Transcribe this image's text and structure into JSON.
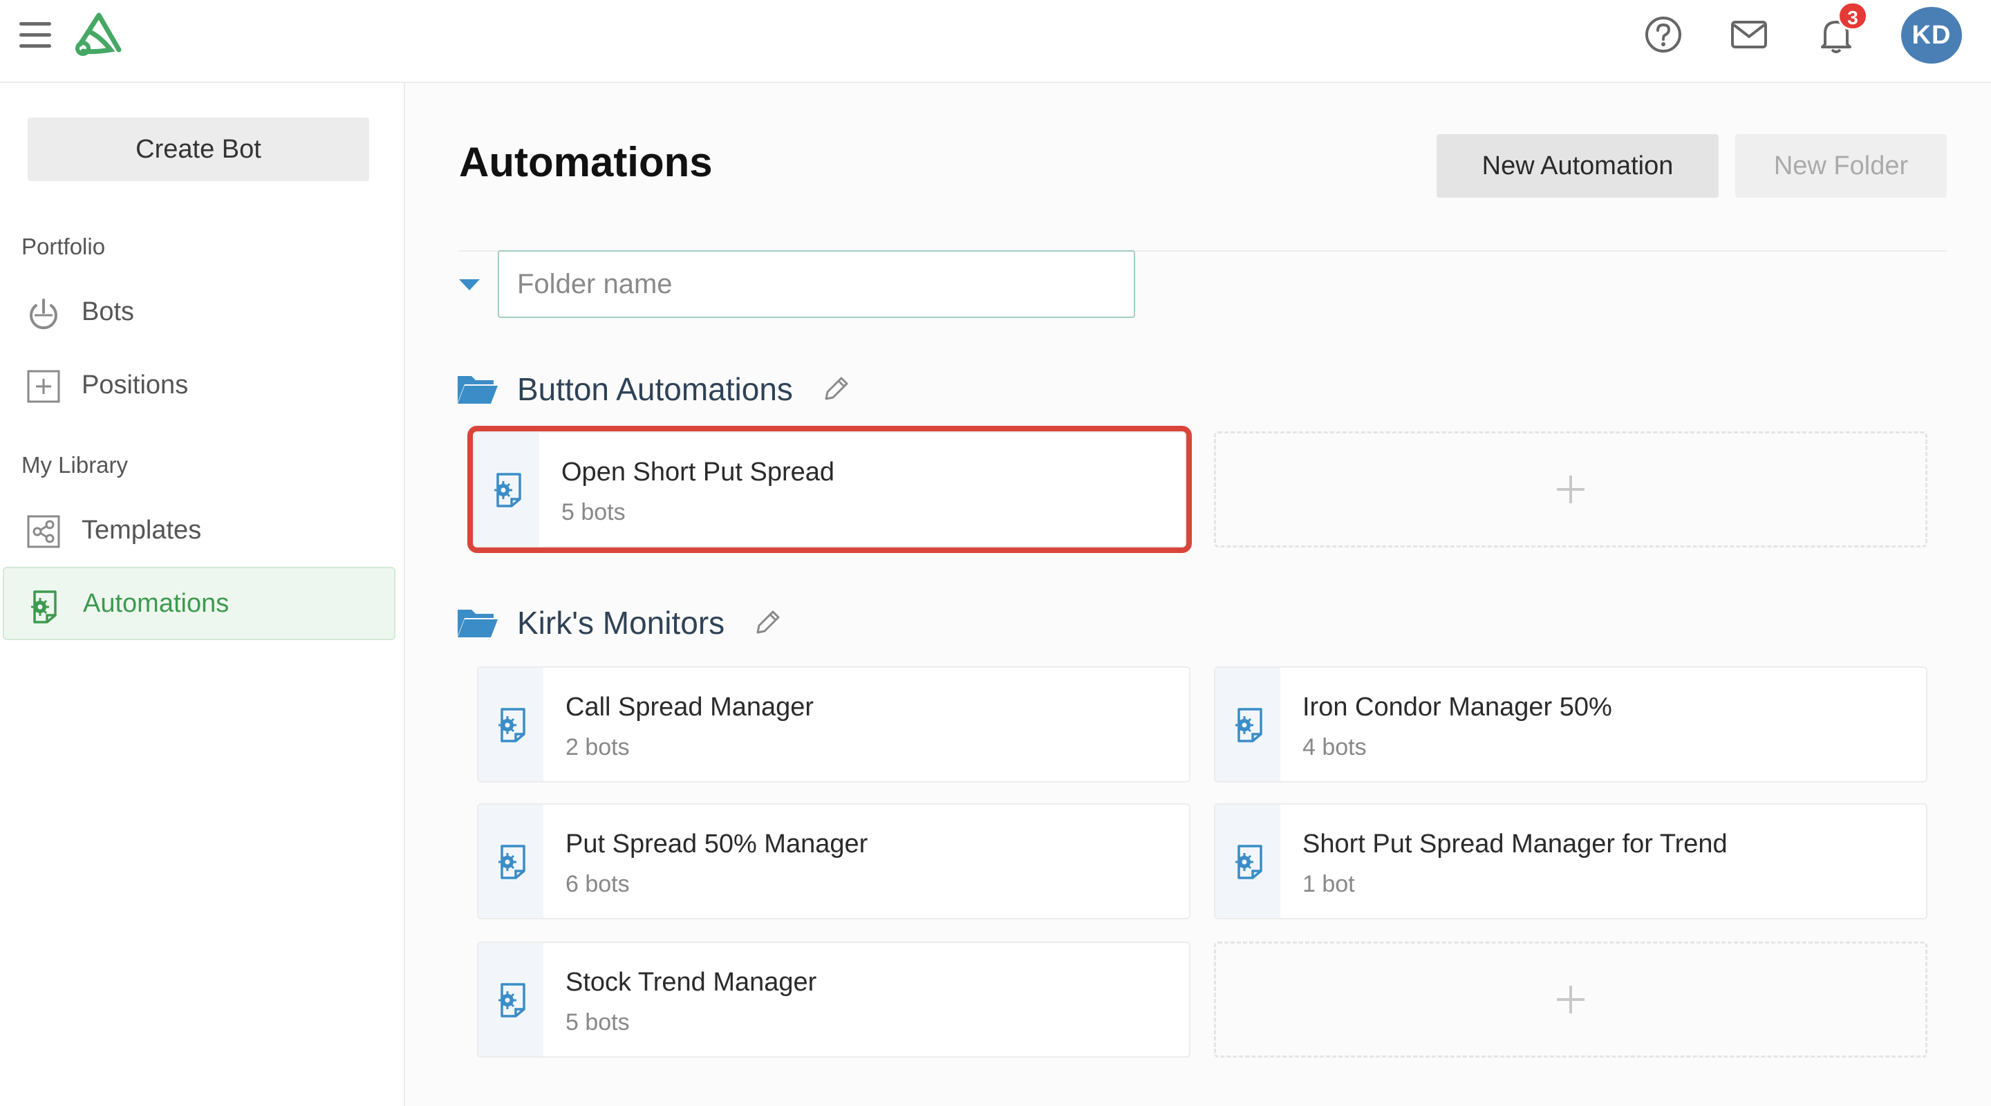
{
  "header": {
    "notification_count": "3",
    "avatar_initials": "KD",
    "icons": [
      "menu-icon",
      "logo-icon",
      "help-icon",
      "mail-icon",
      "bell-icon"
    ]
  },
  "sidebar": {
    "create_bot_label": "Create Bot",
    "portfolio_label": "Portfolio",
    "my_library_label": "My Library",
    "items": [
      {
        "label": "Bots",
        "icon": "power-icon"
      },
      {
        "label": "Positions",
        "icon": "plus-square-icon"
      },
      {
        "label": "Templates",
        "icon": "share-icon"
      },
      {
        "label": "Automations",
        "icon": "automation-icon",
        "active": true
      }
    ]
  },
  "main": {
    "title": "Automations",
    "new_automation_label": "New Automation",
    "new_folder_label": "New Folder",
    "folder_input_placeholder": "Folder name",
    "folders": [
      {
        "name": "Button Automations",
        "cards": [
          {
            "title": "Open Short Put Spread",
            "subtitle": "5 bots",
            "highlighted": true
          }
        ]
      },
      {
        "name": "Kirk's Monitors",
        "cards": [
          {
            "title": "Call Spread Manager",
            "subtitle": "2 bots"
          },
          {
            "title": "Iron Condor Manager 50%",
            "subtitle": "4 bots"
          },
          {
            "title": "Put Spread 50% Manager",
            "subtitle": "6 bots"
          },
          {
            "title": "Short Put Spread Manager for Trend",
            "subtitle": "1 bot"
          },
          {
            "title": "Stock Trend Manager",
            "subtitle": "5 bots"
          }
        ]
      }
    ]
  },
  "colors": {
    "accent_green": "#3d9a4f",
    "accent_blue": "#3a8dc7",
    "highlight_red": "#d9453a",
    "badge_red": "#e53935",
    "avatar_blue": "#4a7fb5"
  }
}
